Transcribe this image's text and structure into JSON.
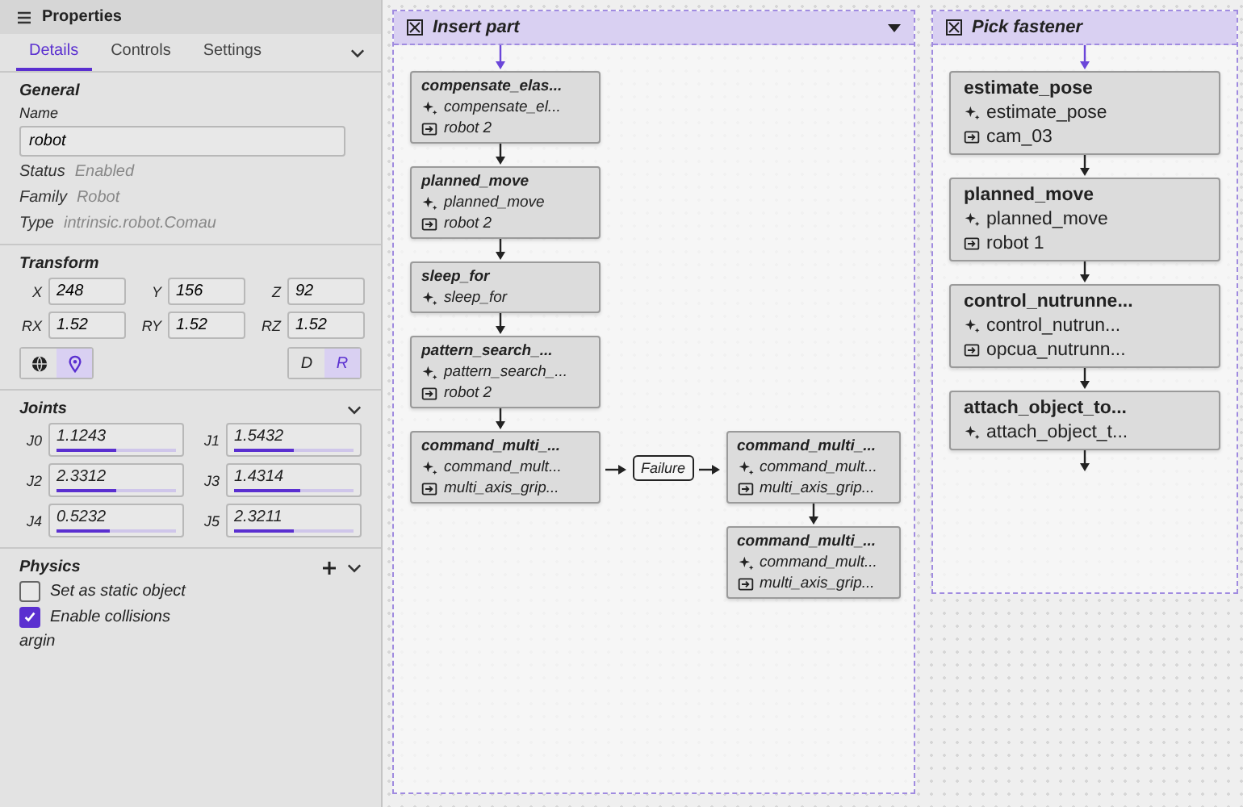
{
  "panel": {
    "title": "Properties",
    "tabs": [
      {
        "label": "Details",
        "selected": true
      },
      {
        "label": "Controls",
        "selected": false
      },
      {
        "label": "Settings",
        "selected": false
      }
    ],
    "general": {
      "heading": "General",
      "name_label": "Name",
      "name_value": "robot",
      "props": [
        {
          "label": "Status",
          "value": "Enabled"
        },
        {
          "label": "Family",
          "value": "Robot"
        },
        {
          "label": "Type",
          "value": "intrinsic.robot.Comau"
        }
      ]
    },
    "transform": {
      "heading": "Transform",
      "fields": [
        {
          "label": "X",
          "value": "248"
        },
        {
          "label": "Y",
          "value": "156"
        },
        {
          "label": "Z",
          "value": "92"
        },
        {
          "label": "RX",
          "value": "1.52"
        },
        {
          "label": "RY",
          "value": "1.52"
        },
        {
          "label": "RZ",
          "value": "1.52"
        }
      ],
      "view_toggle": [
        {
          "kind": "globe",
          "selected": false
        },
        {
          "kind": "pin",
          "selected": true
        }
      ],
      "frame_toggle": [
        {
          "label": "D",
          "selected": false
        },
        {
          "label": "R",
          "selected": true
        }
      ]
    },
    "joints": {
      "heading": "Joints",
      "items": [
        {
          "label": "J0",
          "value": "1.1243",
          "level": 0.5
        },
        {
          "label": "J1",
          "value": "1.5432",
          "level": 0.5
        },
        {
          "label": "J2",
          "value": "2.3312",
          "level": 0.5
        },
        {
          "label": "J3",
          "value": "1.4314",
          "level": 0.55
        },
        {
          "label": "J4",
          "value": "0.5232",
          "level": 0.45
        },
        {
          "label": "J5",
          "value": "2.3211",
          "level": 0.5
        }
      ]
    },
    "physics": {
      "heading": "Physics",
      "options": [
        {
          "label": "Set as static object",
          "checked": false
        },
        {
          "label": "Enable collisions",
          "checked": true
        }
      ],
      "footer": "argin"
    }
  },
  "flow": {
    "groups": [
      {
        "title": "Insert part",
        "nodes": [
          {
            "title": "compensate_elas...",
            "skill": "compensate_el...",
            "resource": "robot 2"
          },
          {
            "title": "planned_move",
            "skill": "planned_move",
            "resource": "robot 2"
          },
          {
            "title": "sleep_for",
            "skill": "sleep_for"
          },
          {
            "title": "pattern_search_...",
            "skill": "pattern_search_...",
            "resource": "robot 2"
          },
          {
            "title": "command_multi_...",
            "skill": "command_mult...",
            "resource": "multi_axis_grip...",
            "failure": {
              "label": "Failure",
              "nodes": [
                {
                  "title": "command_multi_...",
                  "skill": "command_mult...",
                  "resource": "multi_axis_grip..."
                },
                {
                  "title": "command_multi_...",
                  "skill": "command_mult...",
                  "resource": "multi_axis_grip..."
                }
              ]
            }
          }
        ]
      },
      {
        "title": "Pick fastener",
        "nodes": [
          {
            "title": "estimate_pose",
            "skill": "estimate_pose",
            "resource": "cam_03"
          },
          {
            "title": "planned_move",
            "skill": "planned_move",
            "resource": "robot 1"
          },
          {
            "title": "control_nutrunne...",
            "skill": "control_nutrun...",
            "resource": "opcua_nutrunn..."
          },
          {
            "title": "attach_object_to...",
            "skill": "attach_object_t..."
          }
        ]
      }
    ]
  }
}
